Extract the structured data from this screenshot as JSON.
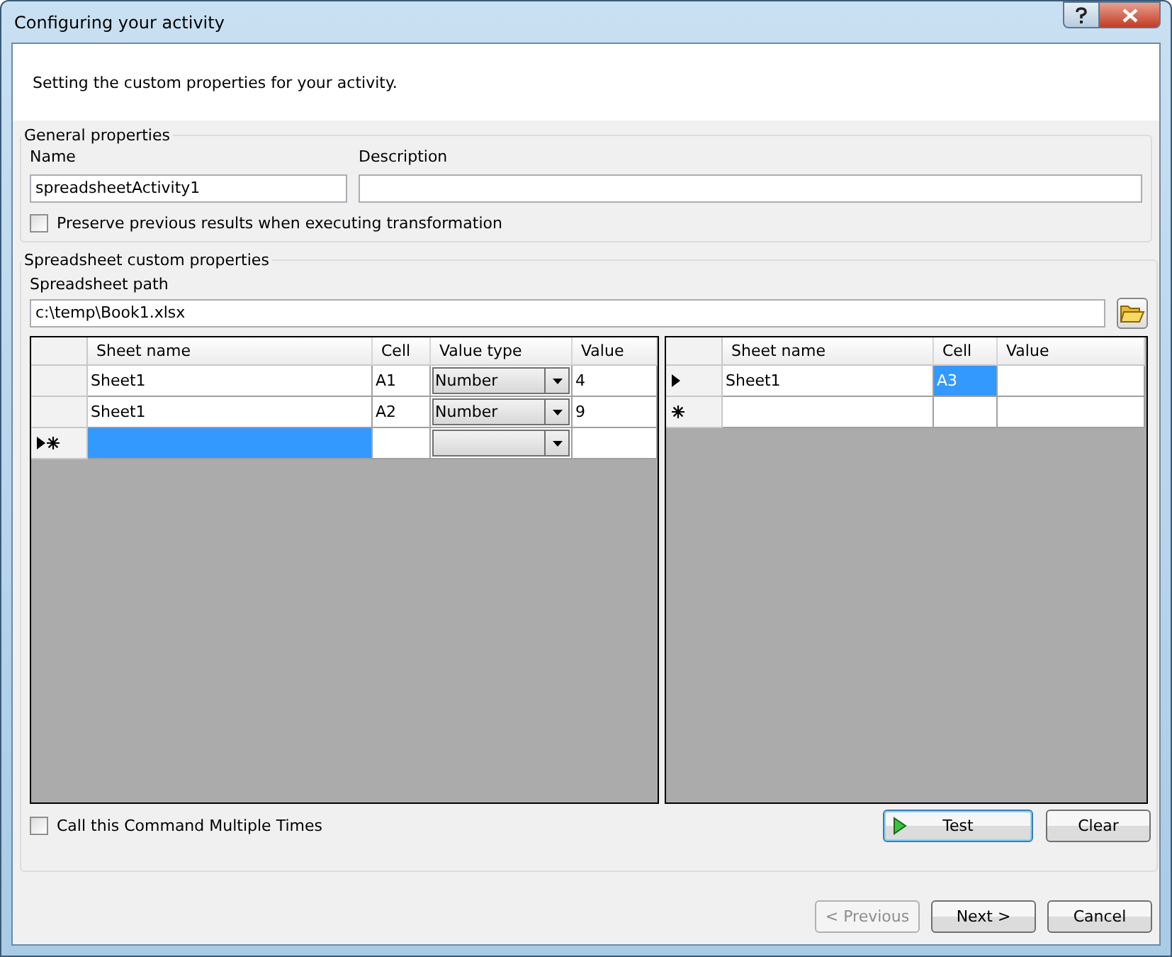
{
  "window": {
    "title": "Configuring your activity"
  },
  "header": {
    "text": "Setting the custom properties for your activity."
  },
  "general": {
    "legend": "General properties",
    "name_label": "Name",
    "name_value": "spreadsheetActivity1",
    "description_label": "Description",
    "preserve": {
      "label": "Preserve previous results when executing transformation",
      "checked": false
    }
  },
  "spreadsheet": {
    "legend": "Spreadsheet custom properties",
    "path_label": "Spreadsheet path",
    "path_value": "c:\\temp\\Book1.xlsx",
    "input_grid": {
      "columns": [
        "Sheet name",
        "Cell",
        "Value type",
        "Value"
      ],
      "rows": [
        {
          "current": false,
          "new": false,
          "cells": [
            {
              "kind": "text",
              "text": "Sheet1",
              "selected": false
            },
            {
              "kind": "text",
              "text": "A1",
              "selected": false
            },
            {
              "kind": "combo",
              "text": "Number",
              "selected": false
            },
            {
              "kind": "text",
              "text": "4",
              "selected": false
            }
          ]
        },
        {
          "current": false,
          "new": false,
          "cells": [
            {
              "kind": "text",
              "text": "Sheet1",
              "selected": false
            },
            {
              "kind": "text",
              "text": "A2",
              "selected": false
            },
            {
              "kind": "combo",
              "text": "Number",
              "selected": false
            },
            {
              "kind": "text",
              "text": "9",
              "selected": false
            }
          ]
        },
        {
          "current": true,
          "new": true,
          "cells": [
            {
              "kind": "text",
              "selected": true
            },
            {
              "kind": "text",
              "selected": false
            },
            {
              "kind": "combo",
              "selected": false
            },
            {
              "kind": "text",
              "selected": false
            }
          ]
        }
      ]
    },
    "output_grid": {
      "columns": [
        "Sheet name",
        "Cell",
        "Value"
      ],
      "rows": [
        {
          "current": true,
          "new": false,
          "cells": [
            {
              "kind": "text",
              "text": "Sheet1",
              "selected": false
            },
            {
              "kind": "text",
              "text": "A3",
              "selected": true
            },
            {
              "kind": "text",
              "selected": false
            }
          ]
        },
        {
          "current": false,
          "new": true,
          "cells": [
            {
              "kind": "text",
              "selected": false
            },
            {
              "kind": "text",
              "selected": false
            },
            {
              "kind": "text",
              "selected": false
            }
          ]
        }
      ]
    },
    "multiple": {
      "label": "Call this Command Multiple Times",
      "checked": false
    },
    "buttons": [
      {
        "label": "Test",
        "kind": "run",
        "focused": true
      },
      {
        "label": "Clear",
        "kind": "plain",
        "focused": false
      }
    ]
  },
  "footer_buttons": [
    {
      "label": "< Previous",
      "disabled": true
    },
    {
      "label": "Next >",
      "disabled": false
    },
    {
      "label": "Cancel",
      "disabled": false
    }
  ]
}
